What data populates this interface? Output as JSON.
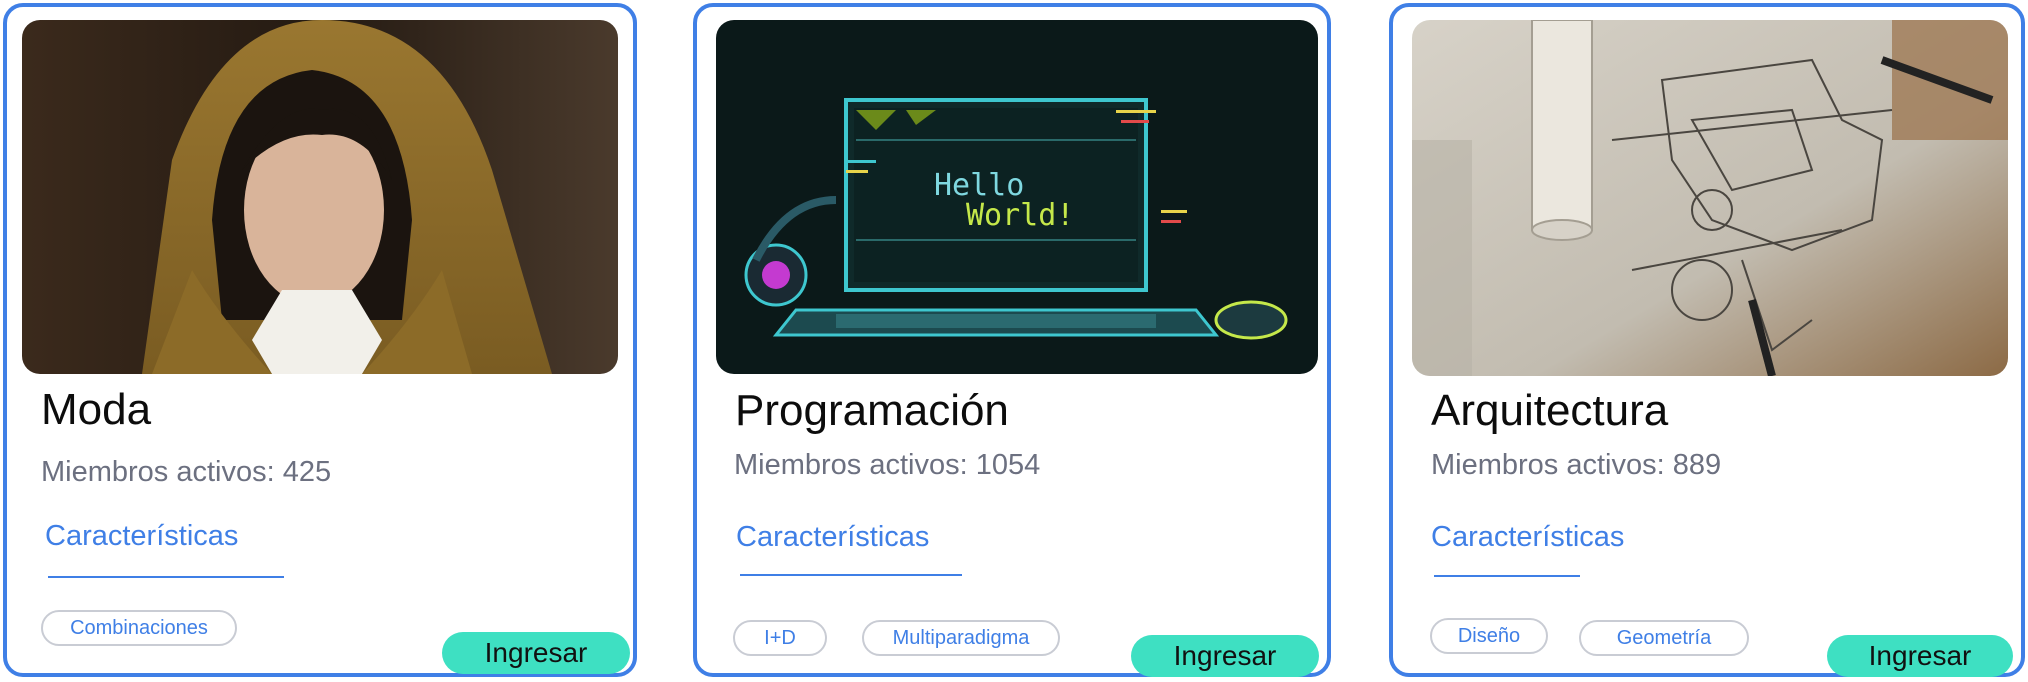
{
  "cards": [
    {
      "title": "Moda",
      "members": "Miembros activos: 425",
      "tab": "Características",
      "chips": [
        "Combinaciones"
      ],
      "button": "Ingresar"
    },
    {
      "title": "Programación",
      "members": "Miembros activos: 1054",
      "tab": "Características",
      "chips": [
        "I+D",
        "Multiparadigma"
      ],
      "button": "Ingresar",
      "image_text": [
        "Hello",
        "World!"
      ]
    },
    {
      "title": "Arquitectura",
      "members": "Miembros activos: 889",
      "tab": "Características",
      "chips": [
        "Diseño",
        "Geometría"
      ],
      "button": "Ingresar"
    }
  ],
  "colors": {
    "accent": "#3f7fe6",
    "button": "#3ee0c2",
    "chip_border": "#c9ccd4",
    "muted_text": "#6c7080"
  },
  "images": [
    "fashion-model-photo",
    "hello-world-laptop-illustration",
    "architecture-blueprint-photo"
  ]
}
